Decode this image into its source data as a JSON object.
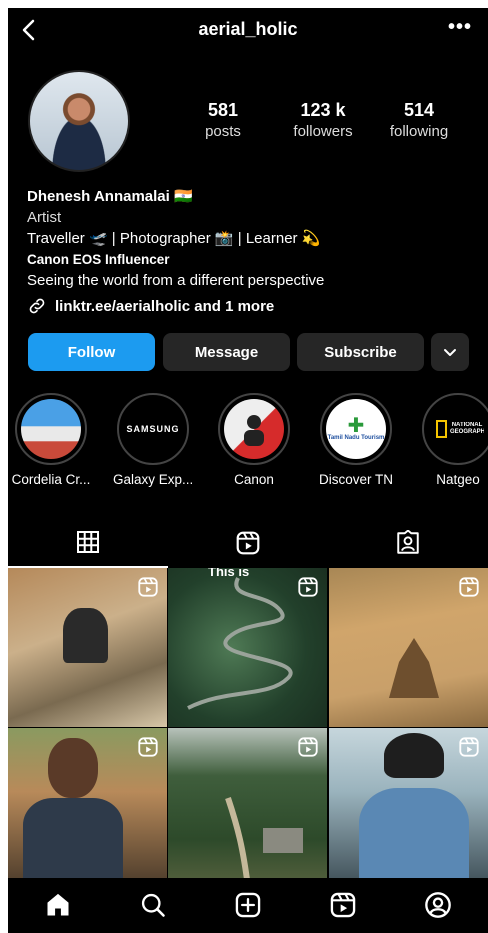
{
  "header": {
    "username": "aerial_holic"
  },
  "profile": {
    "stats": [
      {
        "value": "581",
        "label": "posts"
      },
      {
        "value": "123 k",
        "label": "followers"
      },
      {
        "value": "514",
        "label": "following"
      }
    ],
    "name": "Dhenesh Annamalai 🇮🇳",
    "category": "Artist",
    "bio_line1": "Traveller 🛫 | Photographer 📸 | Learner 💫",
    "bio_line2": "Canon EOS Influencer",
    "bio_line3": "Seeing the world from a different perspective",
    "link": "linktr.ee/aerialholic and 1 more"
  },
  "buttons": {
    "follow": "Follow",
    "message": "Message",
    "subscribe": "Subscribe"
  },
  "highlights": [
    {
      "label": "Cordelia Cr...",
      "logo": ""
    },
    {
      "label": "Galaxy Exp...",
      "logo": "SAMSUNG"
    },
    {
      "label": "Canon",
      "logo": ""
    },
    {
      "label": "Discover TN",
      "logo": "Tamil Nadu Tourism"
    },
    {
      "label": "Natgeo",
      "logo": "NATIONAL GEOGRAPHIC"
    }
  ],
  "grid_posts": [
    {
      "overlay": ""
    },
    {
      "overlay": "This is"
    },
    {
      "overlay": ""
    },
    {
      "overlay": ""
    },
    {
      "overlay": ""
    },
    {
      "overlay": ""
    }
  ],
  "colors": {
    "accent": "#1c9bf0",
    "button": "#262626",
    "background": "#000000"
  },
  "icons": [
    "back-icon",
    "more-icon",
    "link-icon",
    "chevron-down-icon",
    "grid-icon",
    "reels-icon",
    "tagged-icon",
    "home-icon",
    "search-icon",
    "create-icon",
    "profile-icon"
  ]
}
